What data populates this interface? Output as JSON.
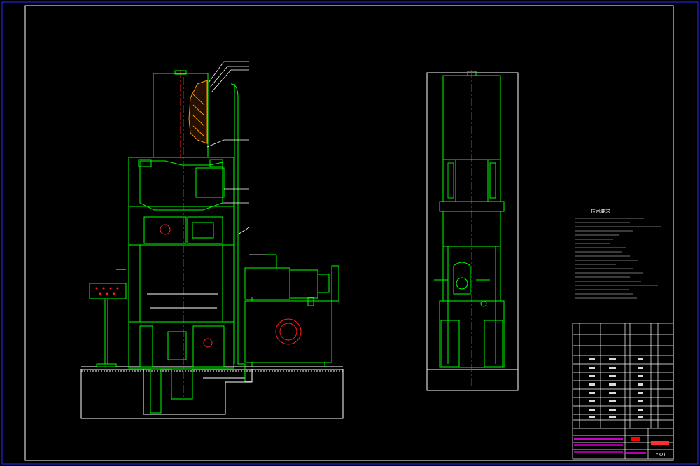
{
  "drawing": {
    "background": "#000000",
    "frame_color": "#2a2aff",
    "line_color": "#00ff00",
    "center_line_color": "#ff2020",
    "annotation_color": "#ffffff",
    "accent_red": "#ff0000",
    "accent_magenta": "#ff00ff"
  },
  "title_block": {
    "model": "Y32T",
    "name_cells": [
      "",
      ""
    ]
  },
  "notes": {
    "heading": "技术要求"
  }
}
